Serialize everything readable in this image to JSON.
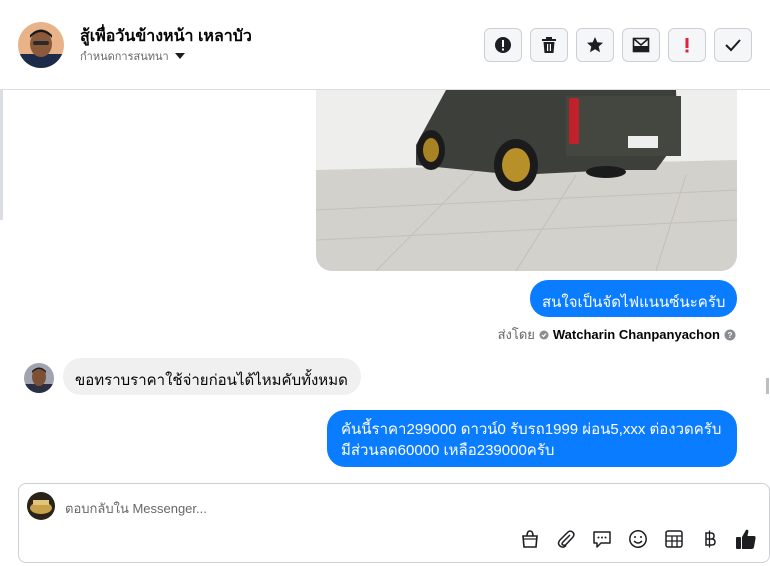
{
  "header": {
    "title": "สู้เพื่อวันข้างหน้า เหลาบัว",
    "subtitle": "กำหนดการสนทนา",
    "actions": [
      {
        "name": "report-button",
        "icon": "alert-icon"
      },
      {
        "name": "delete-button",
        "icon": "trash-icon"
      },
      {
        "name": "star-button",
        "icon": "star-icon"
      },
      {
        "name": "mark-unread-button",
        "icon": "mail-icon"
      },
      {
        "name": "flag-button",
        "icon": "exclamation-icon"
      },
      {
        "name": "done-button",
        "icon": "check-icon"
      }
    ]
  },
  "messages": {
    "outgoing_1": "สนใจเป็นจัดไฟแนนซ์นะครับ",
    "sent_by_label": "ส่งโดย",
    "sent_by_name": "Watcharin Chanpanyachon",
    "incoming_1": "ขอทราบราคาใช้จ่ายก่อนได้ไหมคับทั้งหมด",
    "outgoing_2_line1": "คันนี้ราคา299000 ดาวน์0   รับรถ1999 ผ่อน5,xxx ต่องวดครับ",
    "outgoing_2_line2": "มีส่วนลด60000 เหลือ239000ครับ"
  },
  "composer": {
    "placeholder": "ตอบกลับใน Messenger...",
    "tools": [
      "bag-icon",
      "paperclip-icon",
      "chat-bubble-icon",
      "emoji-icon",
      "table-icon",
      "baht-icon",
      "thumbs-up-icon"
    ]
  },
  "colors": {
    "outgoing_bubble": "#0a7cff",
    "incoming_bubble": "#f0f0f0",
    "flag_red": "#e41e3f"
  }
}
